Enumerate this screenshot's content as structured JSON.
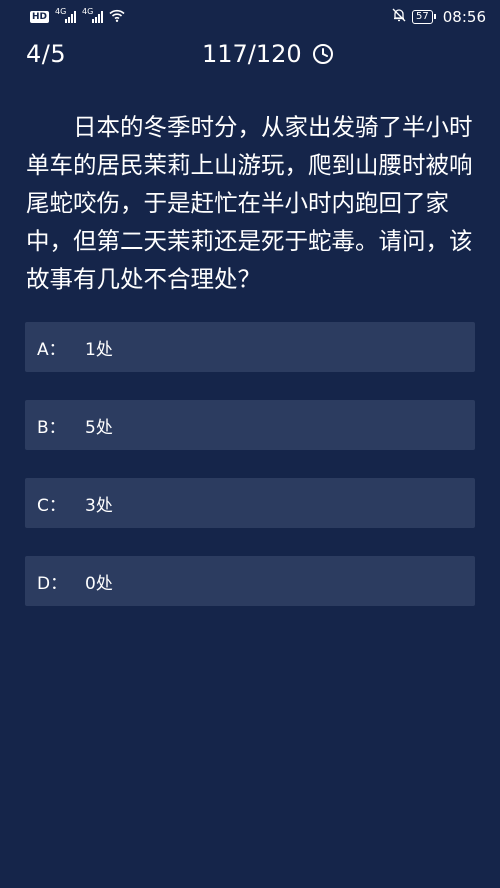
{
  "status_bar": {
    "hd_label": "HD",
    "signal1_tag": "4G",
    "signal2_tag": "4G",
    "battery_level": "57",
    "time": "08:56",
    "icons": [
      "hd-icon",
      "signal-icon",
      "signal-icon",
      "wifi-icon",
      "mute-bell-icon",
      "battery-icon"
    ]
  },
  "header": {
    "progress": "4/5",
    "timer": "117/120",
    "timer_icon": "clock-icon"
  },
  "question": {
    "text": "日本的冬季时分，从家出发骑了半小时单车的居民茉莉上山游玩，爬到山腰时被响尾蛇咬伤，于是赶忙在半小时内跑回了家中，但第二天茉莉还是死于蛇毒。请问，该故事有几处不合理处？"
  },
  "options": [
    {
      "letter": "A：",
      "label": "1处"
    },
    {
      "letter": "B：",
      "label": "5处"
    },
    {
      "letter": "C：",
      "label": "3处"
    },
    {
      "letter": "D：",
      "label": "0处"
    }
  ],
  "colors": {
    "background": "#15254a",
    "option_bg": "#2c3c60",
    "text": "#ffffff"
  }
}
